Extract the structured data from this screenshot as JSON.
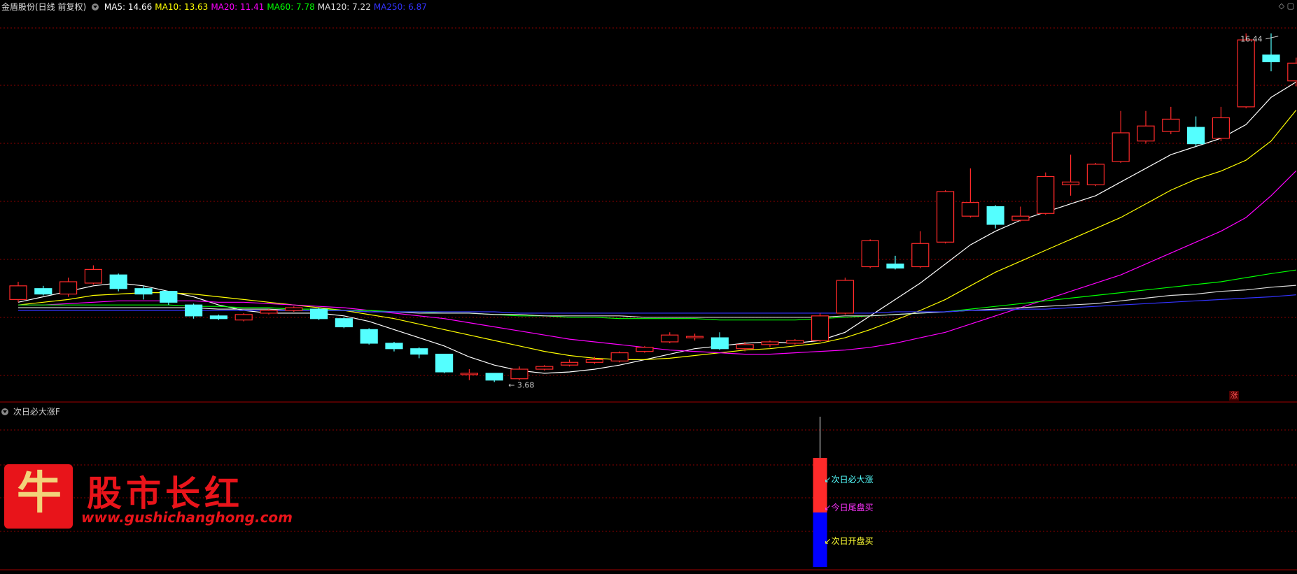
{
  "window": {
    "stock_title": "金盾股份(日线 前复权)"
  },
  "ma_legend": [
    {
      "label": "MA5: 14.66",
      "color": "#ffffff"
    },
    {
      "label": "MA10: 13.63",
      "color": "#ffff00"
    },
    {
      "label": "MA20: 11.41",
      "color": "#ff00ff"
    },
    {
      "label": "MA60: 7.78",
      "color": "#00ff00"
    },
    {
      "label": "MA120: 7.22",
      "color": "#dddddd"
    },
    {
      "label": "MA250: 6.87",
      "color": "#3333ff"
    }
  ],
  "colors": {
    "up": "#ff2a2a",
    "down": "#54ffff",
    "grid": "#8b0000"
  },
  "indicator": {
    "title": "次日必大涨F",
    "signals": [
      {
        "label": "次日必大涨",
        "color": "#ff2a2a",
        "text_color": "#54ffff"
      },
      {
        "label": "今日尾盘买",
        "color": "#ff2a2a",
        "text_color": "#ff33ff"
      },
      {
        "label": "次日开盘买",
        "color": "#0000ff",
        "text_color": "#ffff33"
      }
    ]
  },
  "badge": {
    "zhang": "涨"
  },
  "logo": {
    "title": "股市长红",
    "url": "www.gushichanghong.com",
    "glyph": "牛"
  },
  "chart_data": {
    "type": "candlestick",
    "ylim": [
      3.0,
      17.2
    ],
    "annotations": {
      "high_label": "16.44",
      "low_label": "3.68"
    },
    "candles": [
      {
        "o": 6.7,
        "c": 7.2,
        "h": 7.35,
        "l": 6.6
      },
      {
        "o": 7.1,
        "c": 6.9,
        "h": 7.2,
        "l": 6.85
      },
      {
        "o": 6.9,
        "c": 7.35,
        "h": 7.5,
        "l": 6.8
      },
      {
        "o": 7.3,
        "c": 7.8,
        "h": 7.95,
        "l": 7.25
      },
      {
        "o": 7.6,
        "c": 7.1,
        "h": 7.65,
        "l": 7.0
      },
      {
        "o": 7.1,
        "c": 6.9,
        "h": 7.2,
        "l": 6.7
      },
      {
        "o": 7.0,
        "c": 6.6,
        "h": 7.0,
        "l": 6.5
      },
      {
        "o": 6.5,
        "c": 6.1,
        "h": 6.55,
        "l": 6.0
      },
      {
        "o": 6.1,
        "c": 6.0,
        "h": 6.15,
        "l": 5.95
      },
      {
        "o": 5.95,
        "c": 6.15,
        "h": 6.2,
        "l": 5.9
      },
      {
        "o": 6.2,
        "c": 6.3,
        "h": 6.35,
        "l": 6.15
      },
      {
        "o": 6.3,
        "c": 6.4,
        "h": 6.45,
        "l": 6.25
      },
      {
        "o": 6.35,
        "c": 6.0,
        "h": 6.4,
        "l": 5.95
      },
      {
        "o": 6.0,
        "c": 5.7,
        "h": 6.05,
        "l": 5.65
      },
      {
        "o": 5.6,
        "c": 5.1,
        "h": 5.65,
        "l": 5.05
      },
      {
        "o": 5.1,
        "c": 4.9,
        "h": 5.15,
        "l": 4.8
      },
      {
        "o": 4.9,
        "c": 4.7,
        "h": 4.95,
        "l": 4.55
      },
      {
        "o": 4.7,
        "c": 4.05,
        "h": 4.7,
        "l": 4.0
      },
      {
        "o": 3.95,
        "c": 4.0,
        "h": 4.15,
        "l": 3.75
      },
      {
        "o": 4.0,
        "c": 3.75,
        "h": 4.0,
        "l": 3.68
      },
      {
        "o": 3.8,
        "c": 4.15,
        "h": 4.25,
        "l": 3.75
      },
      {
        "o": 4.15,
        "c": 4.25,
        "h": 4.3,
        "l": 4.1
      },
      {
        "o": 4.3,
        "c": 4.4,
        "h": 4.5,
        "l": 4.25
      },
      {
        "o": 4.4,
        "c": 4.5,
        "h": 4.6,
        "l": 4.35
      },
      {
        "o": 4.45,
        "c": 4.75,
        "h": 4.8,
        "l": 4.4
      },
      {
        "o": 4.8,
        "c": 4.95,
        "h": 5.0,
        "l": 4.75
      },
      {
        "o": 5.15,
        "c": 5.4,
        "h": 5.5,
        "l": 5.1
      },
      {
        "o": 5.3,
        "c": 5.35,
        "h": 5.45,
        "l": 5.2
      },
      {
        "o": 5.3,
        "c": 4.9,
        "h": 5.5,
        "l": 4.85
      },
      {
        "o": 4.9,
        "c": 5.05,
        "h": 5.15,
        "l": 4.8
      },
      {
        "o": 5.05,
        "c": 5.15,
        "h": 5.2,
        "l": 4.95
      },
      {
        "o": 5.1,
        "c": 5.2,
        "h": 5.25,
        "l": 5.05
      },
      {
        "o": 5.2,
        "c": 6.1,
        "h": 6.2,
        "l": 5.15
      },
      {
        "o": 6.2,
        "c": 7.4,
        "h": 7.5,
        "l": 6.15
      },
      {
        "o": 7.9,
        "c": 8.85,
        "h": 8.9,
        "l": 7.85
      },
      {
        "o": 8.0,
        "c": 7.85,
        "h": 8.3,
        "l": 7.8
      },
      {
        "o": 7.9,
        "c": 8.75,
        "h": 9.2,
        "l": 7.85
      },
      {
        "o": 8.8,
        "c": 10.65,
        "h": 10.7,
        "l": 8.75
      },
      {
        "o": 9.75,
        "c": 10.25,
        "h": 11.5,
        "l": 9.7
      },
      {
        "o": 10.1,
        "c": 9.45,
        "h": 10.15,
        "l": 9.3
      },
      {
        "o": 9.6,
        "c": 9.75,
        "h": 10.1,
        "l": 9.55
      },
      {
        "o": 9.85,
        "c": 11.2,
        "h": 11.35,
        "l": 9.8
      },
      {
        "o": 10.9,
        "c": 11.0,
        "h": 12.0,
        "l": 10.5
      },
      {
        "o": 10.9,
        "c": 11.65,
        "h": 11.7,
        "l": 10.85
      },
      {
        "o": 11.75,
        "c": 12.8,
        "h": 13.6,
        "l": 11.7
      },
      {
        "o": 12.5,
        "c": 13.05,
        "h": 13.6,
        "l": 12.4
      },
      {
        "o": 12.85,
        "c": 13.3,
        "h": 13.75,
        "l": 12.75
      },
      {
        "o": 13.0,
        "c": 12.4,
        "h": 13.4,
        "l": 12.3
      },
      {
        "o": 12.6,
        "c": 13.35,
        "h": 13.75,
        "l": 12.5
      },
      {
        "o": 13.75,
        "c": 16.2,
        "h": 16.44,
        "l": 13.7
      },
      {
        "o": 15.65,
        "c": 15.4,
        "h": 16.44,
        "l": 15.05
      },
      {
        "o": 14.7,
        "c": 15.35,
        "h": 15.55,
        "l": 14.5
      }
    ],
    "ma": {
      "MA5": [
        6.6,
        6.8,
        7.0,
        7.2,
        7.3,
        7.2,
        7.0,
        6.8,
        6.5,
        6.3,
        6.2,
        6.2,
        6.2,
        6.1,
        5.9,
        5.6,
        5.3,
        5.0,
        4.6,
        4.3,
        4.1,
        4.0,
        4.05,
        4.15,
        4.3,
        4.5,
        4.7,
        4.9,
        5.0,
        5.1,
        5.15,
        5.1,
        5.2,
        5.5,
        6.1,
        6.7,
        7.3,
        8.0,
        8.7,
        9.2,
        9.6,
        9.9,
        10.2,
        10.5,
        11.0,
        11.5,
        12.0,
        12.3,
        12.6,
        13.1,
        14.1,
        14.66
      ],
      "MA10": [
        6.5,
        6.6,
        6.7,
        6.85,
        6.9,
        6.95,
        6.95,
        6.9,
        6.8,
        6.7,
        6.6,
        6.5,
        6.4,
        6.3,
        6.15,
        6.0,
        5.8,
        5.6,
        5.4,
        5.2,
        5.0,
        4.8,
        4.65,
        4.55,
        4.5,
        4.5,
        4.55,
        4.65,
        4.75,
        4.85,
        4.9,
        5.0,
        5.1,
        5.3,
        5.6,
        5.95,
        6.3,
        6.7,
        7.2,
        7.7,
        8.1,
        8.5,
        8.9,
        9.3,
        9.7,
        10.2,
        10.7,
        11.1,
        11.4,
        11.8,
        12.5,
        13.63
      ],
      "MA20": [
        6.5,
        6.5,
        6.55,
        6.6,
        6.65,
        6.65,
        6.65,
        6.65,
        6.6,
        6.6,
        6.55,
        6.5,
        6.45,
        6.4,
        6.3,
        6.2,
        6.1,
        6.0,
        5.85,
        5.7,
        5.55,
        5.4,
        5.25,
        5.15,
        5.05,
        4.95,
        4.85,
        4.8,
        4.75,
        4.7,
        4.7,
        4.75,
        4.8,
        4.85,
        4.95,
        5.1,
        5.3,
        5.5,
        5.8,
        6.1,
        6.4,
        6.7,
        7.0,
        7.3,
        7.6,
        8.0,
        8.4,
        8.8,
        9.2,
        9.7,
        10.5,
        11.41
      ],
      "MA60": [
        6.5,
        6.5,
        6.5,
        6.5,
        6.5,
        6.5,
        6.5,
        6.45,
        6.45,
        6.4,
        6.4,
        6.35,
        6.35,
        6.3,
        6.3,
        6.25,
        6.25,
        6.2,
        6.2,
        6.15,
        6.1,
        6.1,
        6.05,
        6.05,
        6.0,
        6.0,
        6.0,
        6.0,
        5.95,
        5.95,
        5.95,
        5.95,
        6.0,
        6.05,
        6.1,
        6.15,
        6.2,
        6.25,
        6.35,
        6.45,
        6.55,
        6.65,
        6.75,
        6.85,
        6.95,
        7.05,
        7.15,
        7.25,
        7.35,
        7.5,
        7.65,
        7.78
      ],
      "MA120": [
        6.4,
        6.4,
        6.4,
        6.4,
        6.4,
        6.4,
        6.4,
        6.4,
        6.35,
        6.35,
        6.35,
        6.3,
        6.3,
        6.3,
        6.25,
        6.25,
        6.2,
        6.2,
        6.2,
        6.15,
        6.15,
        6.1,
        6.1,
        6.1,
        6.1,
        6.05,
        6.05,
        6.05,
        6.05,
        6.05,
        6.05,
        6.05,
        6.05,
        6.1,
        6.1,
        6.15,
        6.2,
        6.25,
        6.3,
        6.35,
        6.4,
        6.45,
        6.5,
        6.55,
        6.65,
        6.75,
        6.85,
        6.9,
        7.0,
        7.05,
        7.15,
        7.22
      ],
      "MA250": [
        6.3,
        6.3,
        6.3,
        6.3,
        6.3,
        6.3,
        6.3,
        6.3,
        6.3,
        6.3,
        6.3,
        6.3,
        6.3,
        6.3,
        6.25,
        6.25,
        6.25,
        6.25,
        6.25,
        6.25,
        6.2,
        6.2,
        6.2,
        6.2,
        6.2,
        6.2,
        6.2,
        6.2,
        6.2,
        6.2,
        6.2,
        6.2,
        6.2,
        6.2,
        6.2,
        6.25,
        6.25,
        6.25,
        6.3,
        6.3,
        6.35,
        6.35,
        6.4,
        6.45,
        6.5,
        6.55,
        6.6,
        6.65,
        6.7,
        6.75,
        6.8,
        6.87
      ]
    }
  }
}
